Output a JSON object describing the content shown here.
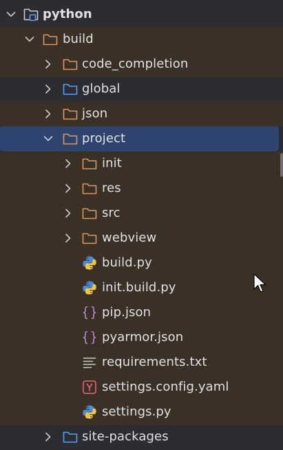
{
  "tree": {
    "items": [
      {
        "label": "python",
        "icon": "project-folder-icon",
        "expanded": true
      },
      {
        "label": "build",
        "icon": "folder-icon",
        "expanded": true
      },
      {
        "label": "code_completion",
        "icon": "folder-icon",
        "expanded": false
      },
      {
        "label": "global",
        "icon": "folder-blue-icon",
        "expanded": false
      },
      {
        "label": "json",
        "icon": "folder-icon",
        "expanded": false
      },
      {
        "label": "project",
        "icon": "folder-icon",
        "expanded": true,
        "selected": true
      },
      {
        "label": "init",
        "icon": "folder-icon",
        "expanded": false
      },
      {
        "label": "res",
        "icon": "folder-icon",
        "expanded": false
      },
      {
        "label": "src",
        "icon": "folder-icon",
        "expanded": false
      },
      {
        "label": "webview",
        "icon": "folder-icon",
        "expanded": false
      },
      {
        "label": "build.py",
        "icon": "python-file-icon"
      },
      {
        "label": "init.build.py",
        "icon": "python-file-icon"
      },
      {
        "label": "pip.json",
        "icon": "json-file-icon"
      },
      {
        "label": "pyarmor.json",
        "icon": "json-file-icon"
      },
      {
        "label": "requirements.txt",
        "icon": "text-file-icon"
      },
      {
        "label": "settings.config.yaml",
        "icon": "yaml-file-icon"
      },
      {
        "label": "settings.py",
        "icon": "python-file-icon"
      },
      {
        "label": "site-packages",
        "icon": "folder-blue-icon",
        "expanded": false
      }
    ]
  },
  "colors": {
    "background": "#2b2d30",
    "highlight_row": "#3a3025",
    "selection": "#2e436e",
    "folder_orange": "#d29a6b",
    "folder_blue": "#5a9ef5",
    "text": "#dfe1e5"
  }
}
